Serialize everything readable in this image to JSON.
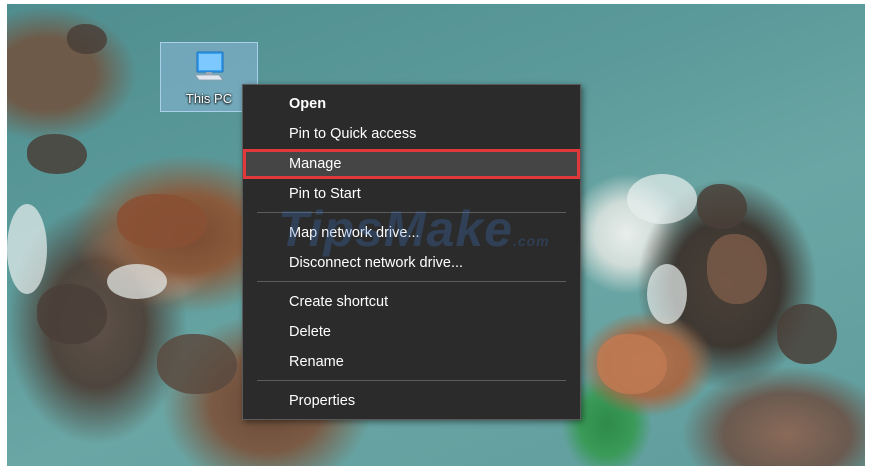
{
  "desktop": {
    "icon_label": "This PC",
    "icon_name": "computer-icon"
  },
  "context_menu": {
    "items": [
      {
        "label": "Open",
        "bold": true
      },
      {
        "label": "Pin to Quick access"
      },
      {
        "label": "Manage",
        "highlighted": true
      },
      {
        "label": "Pin to Start"
      },
      {
        "label": "Map network drive..."
      },
      {
        "label": "Disconnect network drive..."
      },
      {
        "label": "Create shortcut"
      },
      {
        "label": "Delete"
      },
      {
        "label": "Rename"
      },
      {
        "label": "Properties"
      }
    ],
    "highlight_color": "#e0393b",
    "background_color": "#2b2b2b"
  },
  "watermark": {
    "text": "TipsMake",
    "suffix": ".com"
  }
}
